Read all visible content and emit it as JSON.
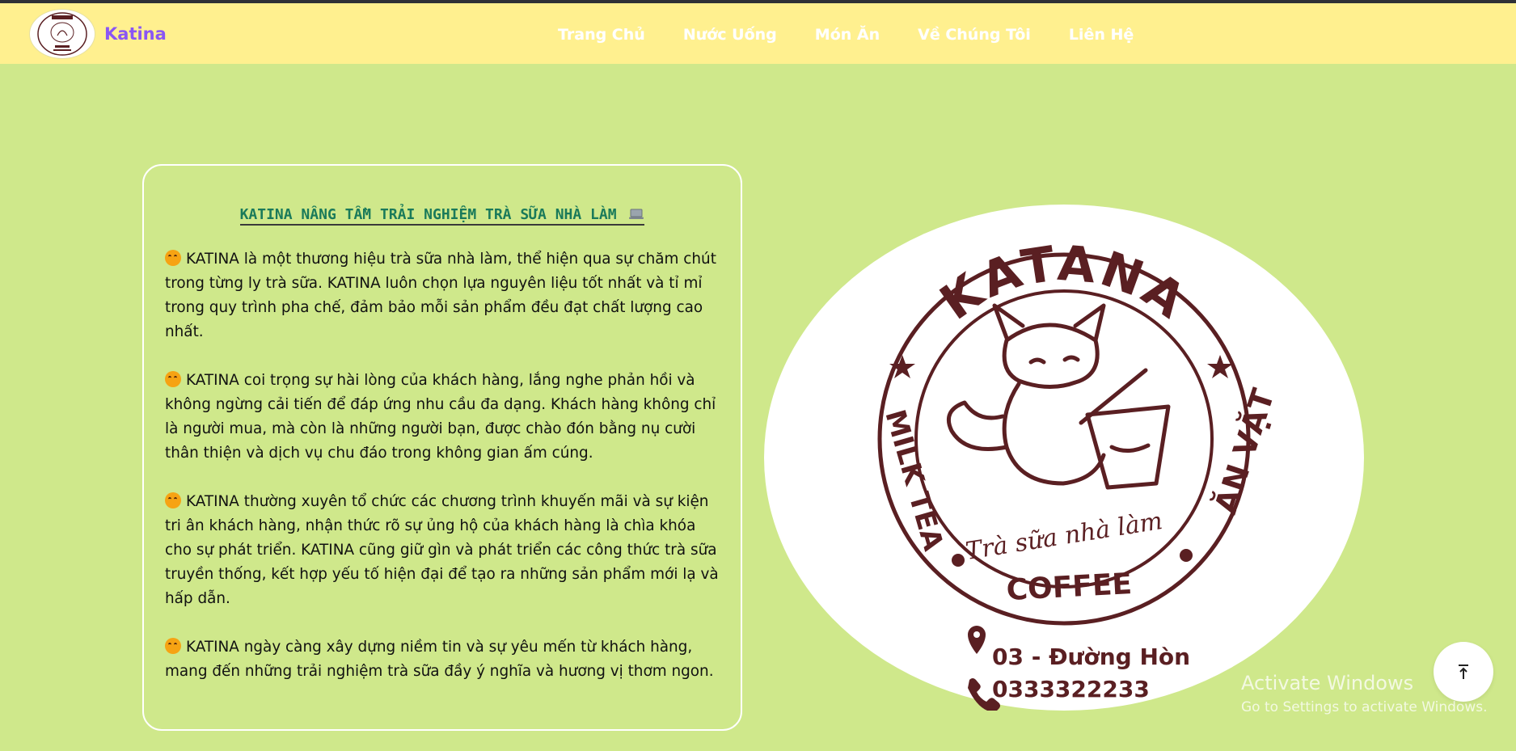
{
  "header": {
    "brand_name": "Katina",
    "nav": [
      {
        "label": "Trang Chủ"
      },
      {
        "label": "Nước Uống"
      },
      {
        "label": "Món Ăn"
      },
      {
        "label": "Về Chúng Tôi"
      },
      {
        "label": "Liên Hệ"
      }
    ]
  },
  "about": {
    "title": "KATINA NÂNG TẦM TRẢI NGHIỆM TRÀ SỮA NHÀ LÀM",
    "title_icon": "laptop-icon",
    "paragraph_icon": "hugging-face-emoji",
    "paragraphs": [
      "KATINA là một thương hiệu trà sữa nhà làm, thể hiện qua sự chăm chút trong từng ly trà sữa. KATINA luôn chọn lựa nguyên liệu tốt nhất và tỉ mỉ trong quy trình pha chế, đảm bảo mỗi sản phẩm đều đạt chất lượng cao nhất.",
      "KATINA coi trọng sự hài lòng của khách hàng, lắng nghe phản hồi và không ngừng cải tiến để đáp ứng nhu cầu đa dạng. Khách hàng không chỉ là người mua, mà còn là những người bạn, được chào đón bằng nụ cười thân thiện và dịch vụ chu đáo trong không gian ấm cúng.",
      "KATINA thường xuyên tổ chức các chương trình khuyến mãi và sự kiện tri ân khách hàng, nhận thức rõ sự ủng hộ của khách hàng là chìa khóa cho sự phát triển. KATINA cũng giữ gìn và phát triển các công thức trà sữa truyền thống, kết hợp yếu tố hiện đại để tạo ra những sản phẩm mới lạ và hấp dẫn.",
      "KATINA ngày càng xây dựng niềm tin và sự yêu mến từ khách hàng, mang đến những trải nghiệm trà sữa đầy ý nghĩa và hương vị thơm ngon."
    ]
  },
  "logo": {
    "brand": "KATANA",
    "left_text": "MILK TEA",
    "right_text": "ĂN VẶT",
    "tagline": "Trà sữa nhà làm",
    "bottom_text": "COFFEE",
    "address": "03 - Đường Hòn",
    "phone": "0333322233"
  },
  "watermark": {
    "line1": "Activate Windows",
    "line2": "Go to Settings to activate Windows."
  },
  "colors": {
    "page_bg": "#cfe88b",
    "header_bg": "#fff08f",
    "brand": "#8a56f4",
    "title": "#1a7a5a",
    "logo_ink": "#5a1f22"
  },
  "scroll_top_icon": "arrow-up-to-top-icon"
}
